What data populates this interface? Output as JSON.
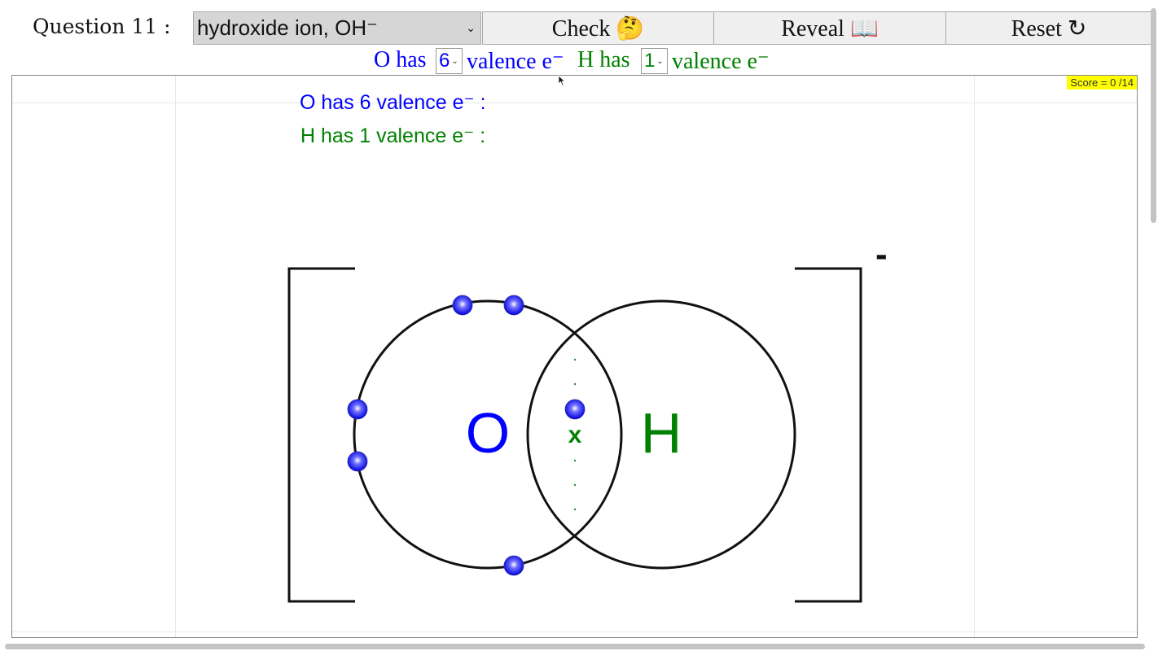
{
  "header": {
    "question_label": "Question 11 :",
    "selected_molecule": "hydroxide ion, OH⁻",
    "check_label": "Check",
    "check_icon": "🤔",
    "reveal_label": "Reveal",
    "reveal_icon": "📖",
    "reset_label": "Reset",
    "reset_icon": "↻"
  },
  "valence_bar": {
    "o_prefix": "O has",
    "o_value": "6",
    "o_suffix": "valence e⁻",
    "h_prefix": "H has",
    "h_value": "1",
    "h_suffix": "valence e⁻"
  },
  "canvas": {
    "score": "Score = 0 /14",
    "o_info": "O has 6 valence e⁻ :",
    "h_info": "H has 1 valence e⁻ :",
    "o_symbol": "O",
    "h_symbol": "H",
    "shared_marker": "x",
    "charge": "-"
  },
  "colors": {
    "oxygen": "#0000ff",
    "hydrogen": "#008000",
    "score_bg": "#ffff00"
  }
}
